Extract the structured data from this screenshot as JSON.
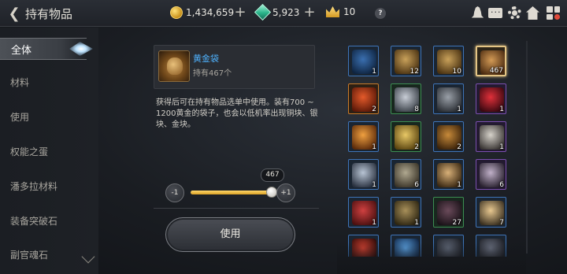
{
  "header": {
    "title": "持有物品",
    "gold": "1,434,659",
    "gems": "5,923",
    "crowns": "10",
    "help": "?"
  },
  "sidebar": {
    "items": [
      {
        "label": "全体",
        "active": true
      },
      {
        "label": "材料"
      },
      {
        "label": "使用"
      },
      {
        "label": "权能之蛋"
      },
      {
        "label": "潘多拉材料"
      },
      {
        "label": "装备突破石"
      },
      {
        "label": "副官魂石"
      }
    ]
  },
  "detail": {
    "name": "黄金袋",
    "owned": "持有467个",
    "description": "获得后可在持有物品选单中使用。装有700 ~ 1200黄金的袋子，也会以低机率出现铜块、银块、金块。",
    "minus_label": "-1",
    "plus_label": "+1",
    "slider_value": "467",
    "slider_fraction": 1.0,
    "use_label": "使用"
  },
  "items": [
    {
      "name": "blue-chest",
      "count": "1",
      "rarity": "blue",
      "colors": [
        "#3a6fb0",
        "#0f2440"
      ]
    },
    {
      "name": "gold-chest",
      "count": "12",
      "rarity": "blue",
      "colors": [
        "#c9a15a",
        "#4a3212"
      ]
    },
    {
      "name": "gold-chest-2",
      "count": "10",
      "rarity": "blue",
      "colors": [
        "#c9a15a",
        "#4a3212"
      ]
    },
    {
      "name": "gold-bag",
      "count": "467",
      "rarity": "gold",
      "selected": true,
      "colors": [
        "#d39a55",
        "#4a2a10"
      ]
    },
    {
      "name": "red-orb",
      "count": "2",
      "rarity": "orange",
      "colors": [
        "#e45a2a",
        "#5a1808"
      ]
    },
    {
      "name": "silver-spear",
      "count": "8",
      "rarity": "green",
      "colors": [
        "#c8cdd6",
        "#3a4048"
      ]
    },
    {
      "name": "spiked-mace",
      "count": "1",
      "rarity": "blue",
      "colors": [
        "#9aa0a8",
        "#2a2e34"
      ]
    },
    {
      "name": "red-crystal",
      "count": "1",
      "rarity": "purple",
      "colors": [
        "#e0303a",
        "#3a0810"
      ]
    },
    {
      "name": "flame-sword",
      "count": "1",
      "rarity": "blue",
      "colors": [
        "#f0a040",
        "#5a2a0a"
      ]
    },
    {
      "name": "gold-tablet",
      "count": "2",
      "rarity": "green",
      "colors": [
        "#e8c866",
        "#5a4410"
      ]
    },
    {
      "name": "gold-ring",
      "count": "2",
      "rarity": "blue",
      "colors": [
        "#c78a3a",
        "#3a220a"
      ]
    },
    {
      "name": "crown-beast",
      "count": "1",
      "rarity": "purple",
      "colors": [
        "#d6d2ca",
        "#3a3634"
      ]
    },
    {
      "name": "silver-ring",
      "count": "1",
      "rarity": "blue",
      "colors": [
        "#b8c4d4",
        "#2a3240"
      ]
    },
    {
      "name": "rope-coil",
      "count": "6",
      "rarity": "blue",
      "colors": [
        "#b0a890",
        "#3a3428"
      ]
    },
    {
      "name": "claw-relic",
      "count": "1",
      "rarity": "blue",
      "colors": [
        "#d8b078",
        "#3a2812"
      ]
    },
    {
      "name": "dark-scythe",
      "count": "6",
      "rarity": "purple",
      "colors": [
        "#c0b0c8",
        "#2a2230"
      ]
    },
    {
      "name": "red-box",
      "count": "1",
      "rarity": "blue",
      "colors": [
        "#d04040",
        "#4a1010"
      ]
    },
    {
      "name": "beast-helm",
      "count": "1",
      "rarity": "blue",
      "colors": [
        "#a8905a",
        "#2e2612"
      ]
    },
    {
      "name": "hero-portrait-dark",
      "count": "27",
      "rarity": "green",
      "colors": [
        "#6a4a5a",
        "#1a1218"
      ]
    },
    {
      "name": "hero-portrait-blond",
      "count": "7",
      "rarity": "blue",
      "colors": [
        "#e8c890",
        "#3a3020"
      ]
    },
    {
      "name": "red-potion",
      "count": "",
      "rarity": "blue",
      "colors": [
        "#d04030",
        "#2a0a08"
      ]
    },
    {
      "name": "blue-shard",
      "count": "",
      "rarity": "blue",
      "colors": [
        "#5aa0e0",
        "#0e2240"
      ]
    },
    {
      "name": "dark-relic",
      "count": "",
      "rarity": "blue",
      "colors": [
        "#606878",
        "#1a1c22"
      ]
    },
    {
      "name": "dark-relic-2",
      "count": "",
      "rarity": "blue",
      "colors": [
        "#6a7080",
        "#1a1c22"
      ]
    }
  ]
}
